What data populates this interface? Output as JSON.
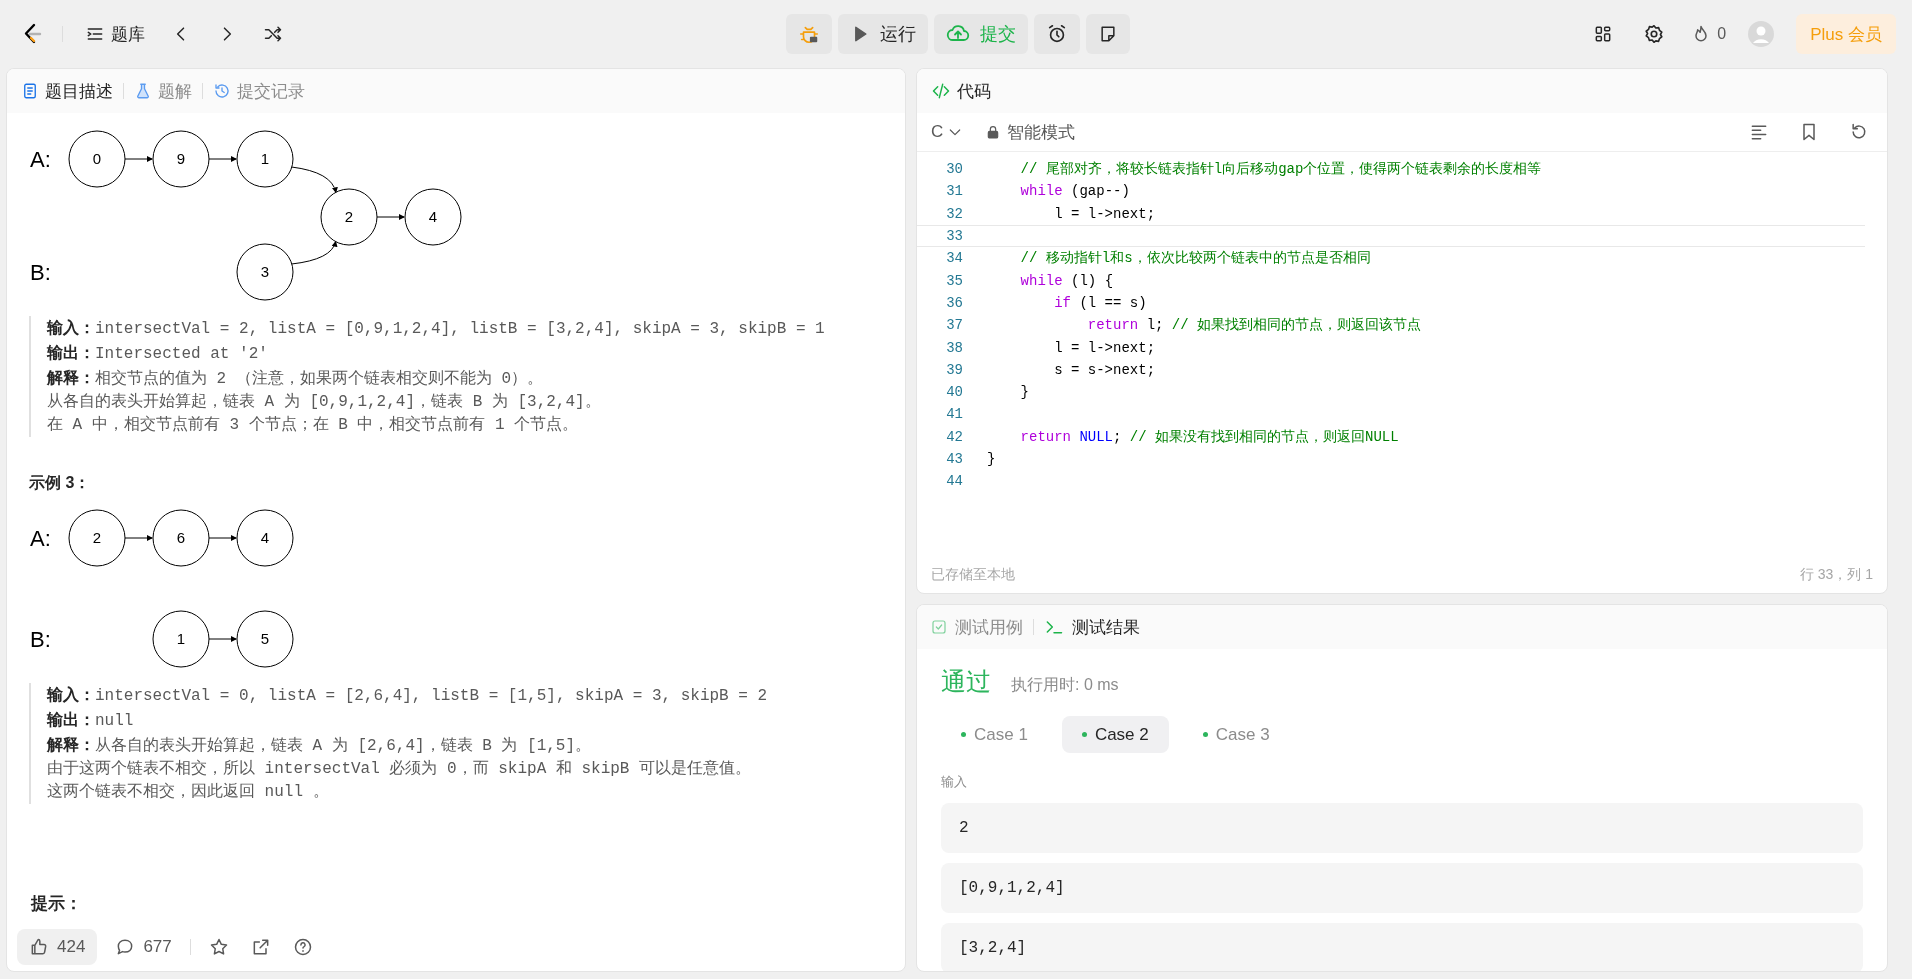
{
  "topbar": {
    "problems_label": "题库",
    "run_label": "运行",
    "submit_label": "提交",
    "streak": "0",
    "plus_label": "Plus 会员"
  },
  "left_tabs": [
    {
      "label": "题目描述",
      "selected": true
    },
    {
      "label": "题解",
      "selected": false
    },
    {
      "label": "提交记录",
      "selected": false
    }
  ],
  "examples": [
    {
      "diagram": {
        "a_label": "A:",
        "b_label": "B:",
        "list_a": [
          "0",
          "9",
          "1"
        ],
        "list_b": [
          "3"
        ],
        "shared": [
          "2",
          "4"
        ]
      },
      "lines": [
        "**输入：**intersectVal = 2, listA = [0,9,1,2,4], listB = [3,2,4], skipA = 3, skipB = 1",
        "**输出：**Intersected at '2'",
        "**解释：**相交节点的值为 2 （注意，如果两个链表相交则不能为 0）。",
        "从各自的表头开始算起，链表 A 为 [0,9,1,2,4]，链表 B 为 [3,2,4]。",
        "在 A 中，相交节点前有 3 个节点；在 B 中，相交节点前有 1 个节点。"
      ]
    },
    {
      "heading": "示例 3：",
      "diagram": {
        "a_label": "A:",
        "b_label": "B:",
        "list_a": [
          "2",
          "6",
          "4"
        ],
        "list_b": [
          "1",
          "5"
        ]
      },
      "lines": [
        "**输入：**intersectVal = 0, listA = [2,6,4], listB = [1,5], skipA = 3, skipB = 2",
        "**输出：**null",
        "**解释：**从各自的表头开始算起，链表 A 为 [2,6,4]，链表 B 为 [1,5]。",
        "由于这两个链表不相交，所以 intersectVal 必须为 0，而 skipA 和 skipB 可以是任意值。",
        "这两个链表不相交，因此返回 null 。"
      ]
    }
  ],
  "hint_heading": "提示：",
  "footer": {
    "likes": "424",
    "comments": "677"
  },
  "code_panel": {
    "title": "代码",
    "language": "C",
    "mode": "智能模式",
    "status": "已存储至本地",
    "cursor": "行 33，列 1",
    "lines": [
      {
        "number": "30",
        "current": false,
        "tokens": [
          {
            "kind": "comment",
            "text": "    // 尾部对齐，将较长链表指针l向后移动gap个位置，使得两个链表剩余的长度相等"
          }
        ]
      },
      {
        "number": "31",
        "current": false,
        "tokens": [
          {
            "kind": "keyword",
            "text": "    while"
          },
          {
            "kind": "plain",
            "text": " (gap--)"
          }
        ]
      },
      {
        "number": "32",
        "current": false,
        "tokens": [
          {
            "kind": "plain",
            "text": "        l = l->next;"
          }
        ]
      },
      {
        "number": "33",
        "current": true
      },
      {
        "number": "34",
        "current": false,
        "tokens": [
          {
            "kind": "comment",
            "text": "    // 移动指针l和s，依次比较两个链表中的节点是否相同"
          }
        ]
      },
      {
        "number": "35",
        "current": false,
        "tokens": [
          {
            "kind": "keyword",
            "text": "    while"
          },
          {
            "kind": "plain",
            "text": " (l) {"
          }
        ]
      },
      {
        "number": "36",
        "current": false,
        "tokens": [
          {
            "kind": "keyword",
            "text": "        if"
          },
          {
            "kind": "plain",
            "text": " (l == s)"
          }
        ]
      },
      {
        "number": "37",
        "current": false,
        "tokens": [
          {
            "kind": "keyword",
            "text": "            return"
          },
          {
            "kind": "plain",
            "text": " l; "
          },
          {
            "kind": "comment",
            "text": "// 如果找到相同的节点，则返回该节点"
          }
        ]
      },
      {
        "number": "38",
        "current": false,
        "tokens": [
          {
            "kind": "plain",
            "text": "        l = l->next;"
          }
        ]
      },
      {
        "number": "39",
        "current": false,
        "tokens": [
          {
            "kind": "plain",
            "text": "        s = s->next;"
          }
        ]
      },
      {
        "number": "40",
        "current": false,
        "tokens": [
          {
            "kind": "plain",
            "text": "    }"
          }
        ]
      },
      {
        "number": "41",
        "current": false
      },
      {
        "number": "42",
        "current": false,
        "tokens": [
          {
            "kind": "keyword",
            "text": "    return"
          },
          {
            "kind": "constant",
            "text": " NULL"
          },
          {
            "kind": "plain",
            "text": "; "
          },
          {
            "kind": "comment",
            "text": "// 如果没有找到相同的节点，则返回NULL"
          }
        ]
      },
      {
        "number": "43",
        "current": false,
        "tokens": [
          {
            "kind": "plain",
            "text": "}"
          }
        ]
      },
      {
        "number": "44",
        "current": false
      }
    ]
  },
  "test_panel": {
    "tabs": [
      {
        "label": "测试用例",
        "selected": false
      },
      {
        "label": "测试结果",
        "selected": true
      }
    ],
    "verdict": "通过",
    "runtime": "执行用时: 0 ms",
    "cases": [
      {
        "label": "Case 1",
        "selected": false,
        "color": "#2db55d"
      },
      {
        "label": "Case 2",
        "selected": true,
        "color": "#2db55d"
      },
      {
        "label": "Case 3",
        "selected": false,
        "color": "#2db55d"
      }
    ],
    "input_label": "输入",
    "inputs": [
      "2",
      "[0,9,1,2,4]",
      "[3,2,4]"
    ]
  }
}
